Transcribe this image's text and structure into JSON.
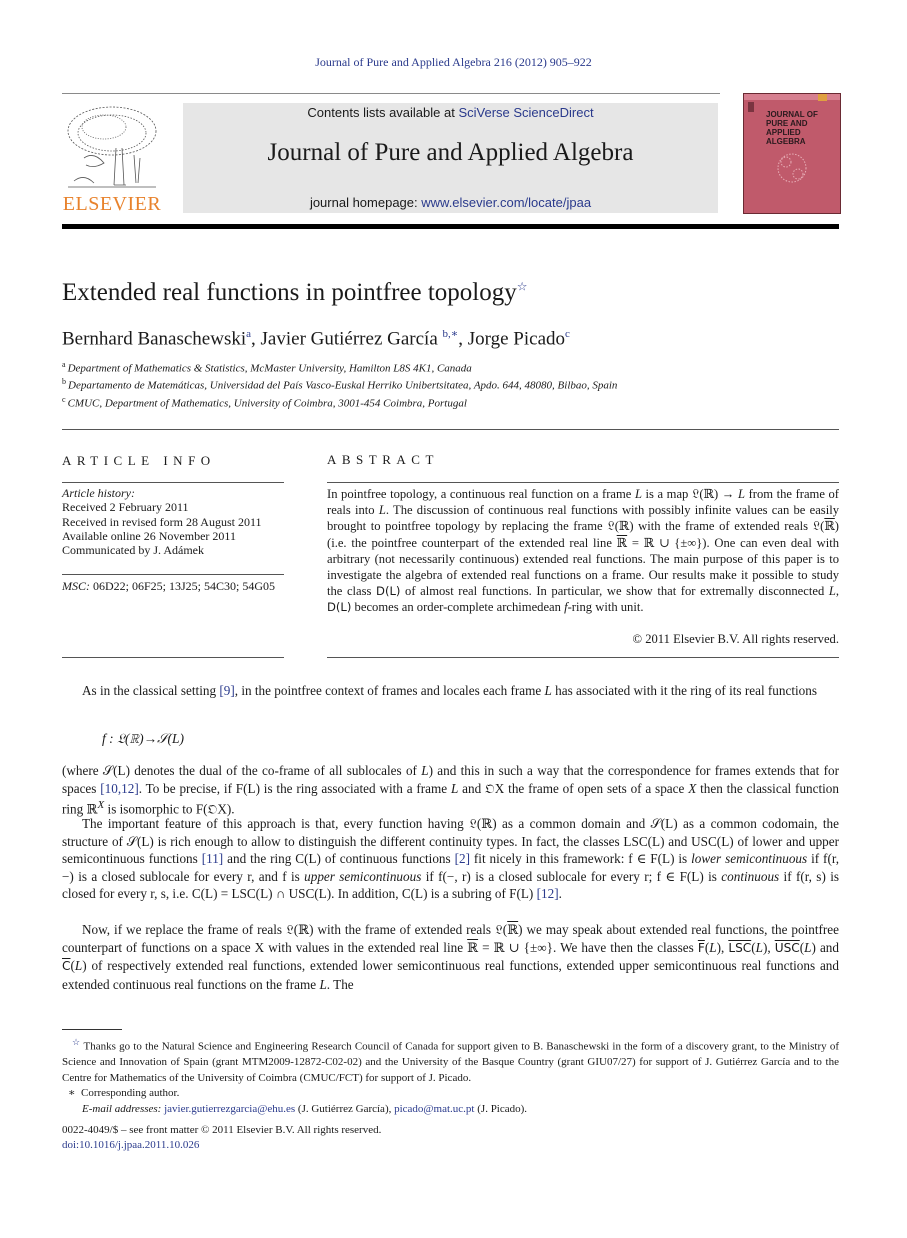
{
  "header": {
    "citation": "Journal of Pure and Applied Algebra 216 (2012) 905–922",
    "contents_prefix": "Contents lists available at ",
    "contents_link": "SciVerse ScienceDirect",
    "journal_name": "Journal of Pure and Applied Algebra",
    "homepage_prefix": "journal homepage: ",
    "homepage_link": "www.elsevier.com/locate/jpaa",
    "publisher_logo_text": "ELSEVIER",
    "cover_title_lines": [
      "JOURNAL OF",
      "PURE AND",
      "APPLIED ALGEBRA"
    ],
    "colors": {
      "link": "#2a3a8c",
      "publisher_orange": "#e8822c",
      "cover": "#c05a6b",
      "masthead_bg": "#e6e6e6"
    }
  },
  "article": {
    "title": "Extended real functions in pointfree topology",
    "title_note_mark": "☆",
    "authors": [
      {
        "name": "Bernhard Banaschewski",
        "sup": "a"
      },
      {
        "name": "Javier Gutiérrez García",
        "sup": "b,∗"
      },
      {
        "name": "Jorge Picado",
        "sup": "c"
      }
    ],
    "affiliations": [
      {
        "mark": "a",
        "text": "Department of Mathematics & Statistics, McMaster University, Hamilton L8S 4K1, Canada"
      },
      {
        "mark": "b",
        "text": "Departamento de Matemáticas, Universidad del País Vasco-Euskal Herriko Unibertsitatea, Apdo. 644, 48080, Bilbao, Spain"
      },
      {
        "mark": "c",
        "text": "CMUC, Department of Mathematics, University of Coimbra, 3001-454 Coimbra, Portugal"
      }
    ]
  },
  "article_info": {
    "heading": "ARTICLE INFO",
    "history_label": "Article history:",
    "history": [
      "Received 2 February 2011",
      "Received in revised form 28 August 2011",
      "Available online 26 November 2011",
      "Communicated by J. Adámek"
    ],
    "msc_label": "MSC:",
    "msc_codes": "06D22; 06F25; 13J25; 54C30; 54G05"
  },
  "abstract": {
    "heading": "ABSTRACT",
    "s1": "In pointfree topology, a continuous real function on a frame ",
    "s2": " is a map 𝔏(ℝ) → ",
    "s3": " from the frame of reals into ",
    "s4": ". The discussion of continuous real functions with possibly infinite values can be easily brought to pointfree topology by replacing the frame 𝔏(ℝ) with the frame of extended reals 𝔏(",
    "s5": ") (i.e. the pointfree counterpart of the extended real line ",
    "s6": " = ℝ ∪ {±∞}). One can even deal with arbitrary (not necessarily continuous) extended real functions. The main purpose of this paper is to investigate the algebra of extended real functions on a frame. Our results make it possible to study the class ",
    "s7": " of almost real functions. In particular, we show that for extremally disconnected ",
    "s8": " becomes an order-complete archimedean ",
    "s9": "-ring with unit.",
    "L": "L",
    "Rbar": "ℝ",
    "DL": "D(L)",
    "f": "f",
    "copyright": "© 2011 Elsevier B.V. All rights reserved."
  },
  "body": {
    "p1a": "As in the classical setting ",
    "ref9": "[9]",
    "p1b": ", in the pointfree context of frames and locales each frame ",
    "p1c": " has associated with it the ring of its real functions",
    "display": "f :  𝔏(ℝ)→𝒮(L)",
    "p2a": "(where 𝒮(L) denotes the dual of the co-frame of all sublocales of ",
    "p2b": ") and this in such a way that the correspondence for frames extends that for spaces ",
    "ref10_12": "[10,12]",
    "p2c": ". To be precise, if F(L) is the ring associated with a frame ",
    "p2d": " and 𝔒X the frame of open sets of a space ",
    "p2e": " then the classical function ring ℝ",
    "p2f": " is isomorphic to F(𝔒X).",
    "X": "X",
    "p3a": "The important feature of this approach is that, every function having 𝔏(ℝ) as a common domain and 𝒮(L) as a common codomain, the structure of 𝒮(L) is rich enough to allow to distinguish the different continuity types. In fact, the classes LSC(L) and USC(L) of lower and upper semicontinuous functions ",
    "ref11": "[11]",
    "p3b": " and the ring C(L) of continuous functions ",
    "ref2": "[2]",
    "p3c": " fit nicely in this framework: f ∈ F(L) is ",
    "lsc_term": "lower semicontinuous",
    "p3d": " if f(r, −) is a closed sublocale for every r, and f is ",
    "usc_term": "upper semicontinuous",
    "p3e": " if f(−, r) is a closed sublocale for every r; f ∈ F(L) is ",
    "cont_term": "continuous",
    "p3f": " if f(r, s) is closed for every r, s, i.e. C(L) = LSC(L) ∩ USC(L). In addition, C(L) is a subring of F(L) ",
    "ref12": "[12]",
    "p3g": ".",
    "p4a": "Now, if we replace the frame of reals 𝔏(ℝ) with the frame of extended reals 𝔏(",
    "p4b": ") we may speak about extended real functions, the pointfree counterpart of functions on a space X with values in the extended real line ",
    "p4c": " = ℝ ∪ {±∞}. We have then the classes ",
    "F": "F",
    "LSC": "LSC",
    "USC": "USC",
    "C": "C",
    "p4d": " of respectively extended real functions, extended lower semicontinuous real functions, extended upper semicontinuous real functions and extended continuous real functions on the frame ",
    "p4e": ". The"
  },
  "footnotes": {
    "star_mark": "☆",
    "star_text": "Thanks go to the Natural Science and Engineering Research Council of Canada for support given to B. Banaschewski in the form of a discovery grant, to the Ministry of Science and Innovation of Spain (grant MTM2009-12872-C02-02) and the University of the Basque Country (grant GIU07/27) for support of J. Gutiérrez García and to the Centre for Mathematics of the University of Coimbra (CMUC/FCT) for support of J. Picado.",
    "corr_mark": "∗",
    "corr_text": "Corresponding author.",
    "email_label": "E-mail addresses:",
    "email1": "javier.gutierrezgarcia@ehu.es",
    "email1_owner": " (J. Gutiérrez García), ",
    "email2": "picado@mat.uc.pt",
    "email2_owner": " (J. Picado)."
  },
  "footer": {
    "issn": "0022-4049/$ – see front matter © 2011 Elsevier B.V. All rights reserved.",
    "doi": "doi:10.1016/j.jpaa.2011.10.026"
  }
}
